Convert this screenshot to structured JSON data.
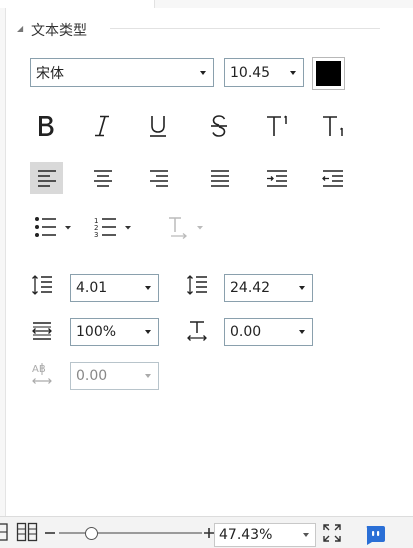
{
  "section": {
    "title": "文本类型"
  },
  "font": {
    "family": "宋体",
    "size": "10.45",
    "color": "#000000"
  },
  "spacing": {
    "line_before": "4.01",
    "line_after": "24.42",
    "scale": "100%",
    "offset": "0.00",
    "char_spacing": "0.00"
  },
  "statusbar": {
    "zoom": "47.43%"
  },
  "colors": {
    "accent": "#2a6fd6",
    "selected_bg": "#d9d9d9",
    "field_border": "#8aa0ad"
  }
}
